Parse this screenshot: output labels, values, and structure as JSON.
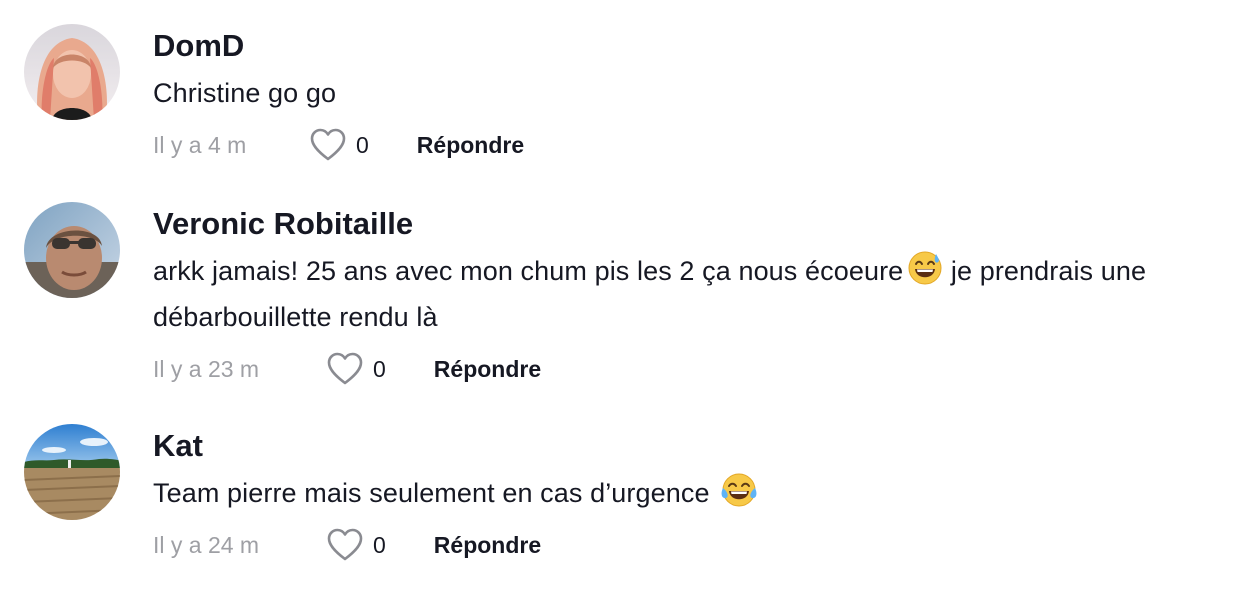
{
  "comments": [
    {
      "username": "DomD",
      "text": "Christine go go",
      "time": "Il y a 4 m",
      "likes": "0",
      "reply_label": "Répondre"
    },
    {
      "username": "Veronic Robitaille",
      "text_part1": "arkk jamais! 25 ans avec mon chum pis les 2 ça nous écoeure",
      "text_part2": " je prendrais une débarbouillette rendu là",
      "emoji": "grinning-face-with-sweat",
      "time": "Il y a 23 m",
      "likes": "0",
      "reply_label": "Répondre"
    },
    {
      "username": "Kat",
      "text": "Team pierre mais seulement en cas d’urgence ",
      "emoji": "face-with-tears-of-joy",
      "time": "Il y a 24 m",
      "likes": "0",
      "reply_label": "Répondre"
    }
  ],
  "icons": {
    "like": "heart-outline-icon"
  },
  "colors": {
    "text": "#161823",
    "meta": "#9e9fa4"
  }
}
